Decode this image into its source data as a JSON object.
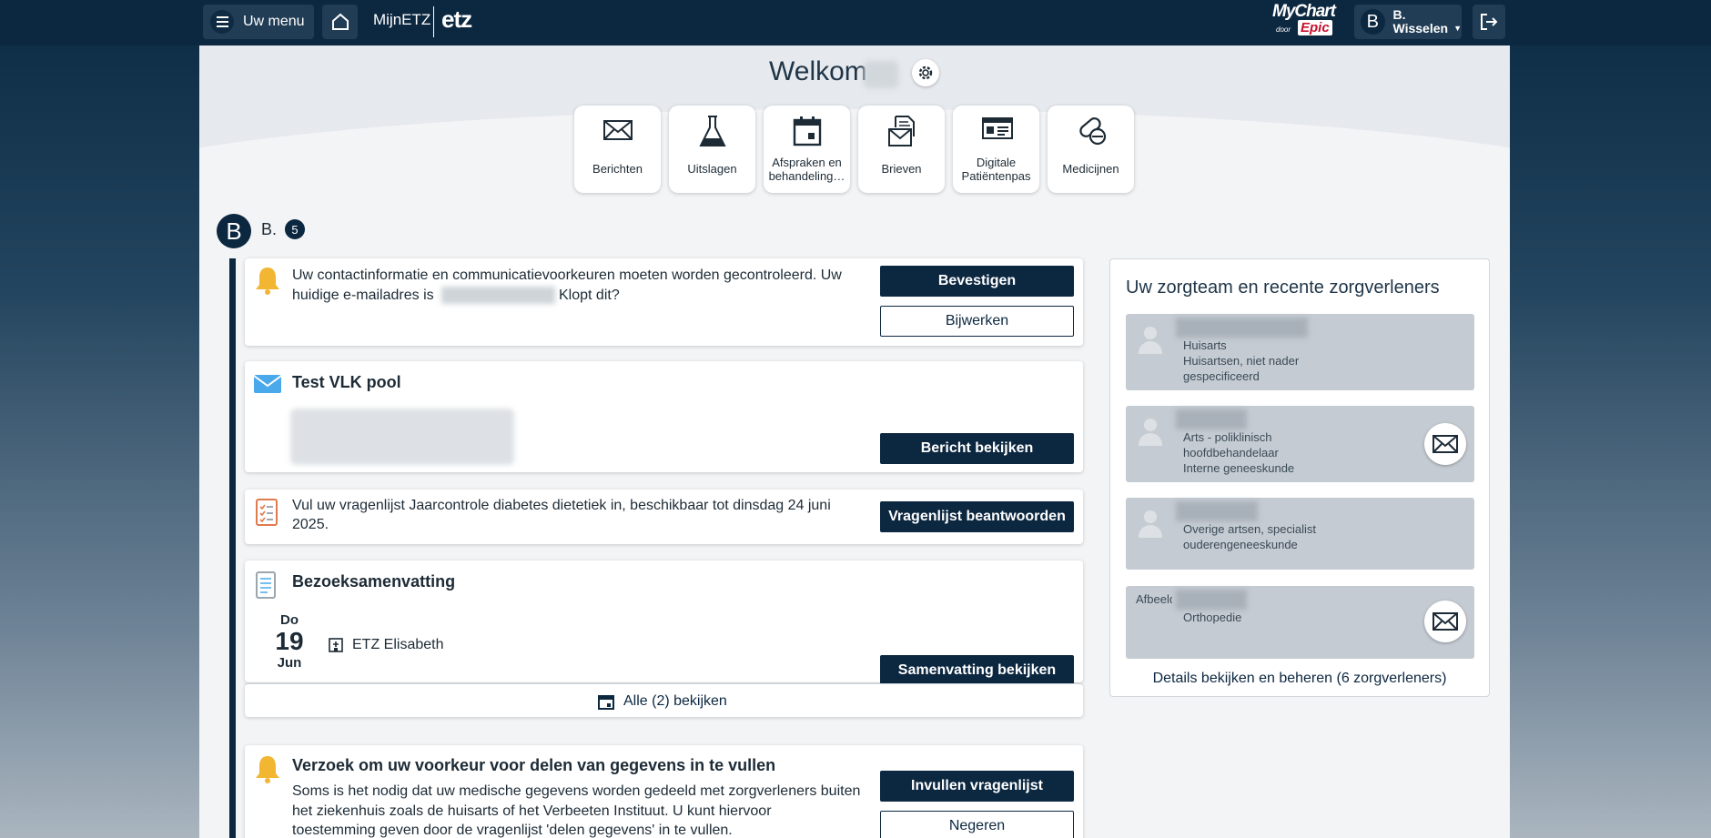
{
  "topbar": {
    "menu_label": "Uw menu",
    "brand": "MijnETZ",
    "brand_logo": "etz",
    "mychart": "MyChart",
    "mychart_by": "door",
    "mychart_epic": "Epic",
    "user_initial": "B",
    "user_name": "B.",
    "user_action": "Wisselen"
  },
  "hero": {
    "welcome": "Welkom",
    "tiles": [
      {
        "label": "Berichten",
        "icon": "envelope-icon"
      },
      {
        "label": "Uitslagen",
        "icon": "flask-icon"
      },
      {
        "label": "Afspraken en behandeling…",
        "icon": "calendar-icon"
      },
      {
        "label": "Brieven",
        "icon": "letters-icon"
      },
      {
        "label": "Digitale Patiëntenpas",
        "icon": "id-card-icon"
      },
      {
        "label": "Medicijnen",
        "icon": "pills-icon"
      }
    ]
  },
  "patient": {
    "initial": "B",
    "name": "B.",
    "count": "5"
  },
  "cards": {
    "contact": {
      "text_1": "Uw contactinformatie en communicatievoorkeuren moeten worden gecontroleerd. Uw",
      "text_2_pre": "huidige e-mailadres is",
      "text_2_post": "Klopt dit?",
      "confirm": "Bevestigen",
      "update": "Bijwerken"
    },
    "message": {
      "title": "Test VLK pool",
      "button": "Bericht bekijken"
    },
    "questionnaire": {
      "text_1": "Vul uw vragenlijst Jaarcontrole diabetes dietetiek in, beschikbaar tot dinsdag 24 juni",
      "text_2": "2025.",
      "button": "Vragenlijst beantwoorden"
    },
    "visit": {
      "title": "Bezoeksamenvatting",
      "weekday": "Do",
      "day": "19",
      "month": "Jun",
      "location": "ETZ Elisabeth",
      "button": "Samenvatting bekijken",
      "all_link": "Alle (2) bekijken"
    },
    "sharing": {
      "title": "Verzoek om uw voorkeur voor delen van gegevens in te vullen",
      "text_1": "Soms is het nodig dat uw medische gegevens worden gedeeld met zorgverleners buiten",
      "text_2": "het ziekenhuis zoals de huisarts of het Verbeeten Instituut. U kunt hiervoor",
      "text_3": "toestemming geven door de vragenlijst 'delen gegevens' in te vullen.",
      "fill": "Invullen vragenlijst",
      "ignore": "Negeren"
    }
  },
  "careteam": {
    "heading": "Uw zorgteam en recente zorgverleners",
    "providers": [
      {
        "role_1": "Huisarts",
        "role_2": "Huisartsen, niet nader",
        "role_3": "gespecificeerd"
      },
      {
        "role_1": "Arts - poliklinisch",
        "role_2": "hoofdbehandelaar",
        "role_3": "Interne geneeskunde"
      },
      {
        "role_1": "Overige artsen, specialist",
        "role_2": "ouderengeneeskunde"
      },
      {
        "role_1": "Orthopedie",
        "alt": "Afbeelding"
      }
    ],
    "details_link": "Details bekijken en beheren (6 zorgverleners)"
  }
}
